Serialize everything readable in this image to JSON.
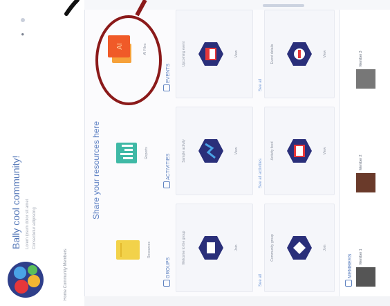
{
  "page": {
    "title": "Bally cool community!",
    "subtitle_1": "Lorem ipsum dolor sit amet",
    "subtitle_2": "Consectetur adipiscing",
    "header_tabs": "Home Community Members"
  },
  "share_heading": "Share your resources here",
  "categories": [
    {
      "label": "Resources",
      "color": "#f2d24a"
    },
    {
      "label": "Reports",
      "color": "#3fb9a6"
    },
    {
      "label": "AI Files",
      "color": "#f05a28"
    }
  ],
  "sections": {
    "groups": "GROUPS",
    "activities": "ACTIVITIES",
    "events": "EVENTS"
  },
  "cards": [
    {
      "caption": "Welcome to the group",
      "footer": "Join"
    },
    {
      "caption": "Sample activity",
      "footer": "View"
    },
    {
      "caption": "Upcoming event",
      "footer": "View"
    },
    {
      "caption": "Community group",
      "footer": "Join"
    },
    {
      "caption": "Activity feed",
      "footer": "View"
    },
    {
      "caption": "Event details",
      "footer": "View"
    }
  ],
  "links": {
    "groups": "See all",
    "activities": "See all activities",
    "events": "See all"
  },
  "members": {
    "title": "MEMBERS",
    "items": [
      {
        "name": "Member 1"
      },
      {
        "name": "Member 2"
      },
      {
        "name": "Member 3"
      }
    ]
  },
  "colors": {
    "accent": "#5f82c0",
    "annotation": "#8b1a1a"
  }
}
